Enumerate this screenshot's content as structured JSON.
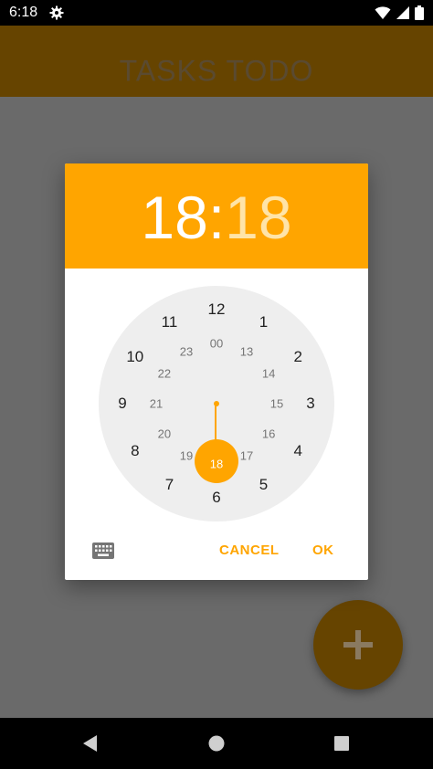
{
  "status_bar": {
    "time": "6:18",
    "icons": [
      "settings-gear-icon",
      "wifi-icon",
      "signal-icon",
      "battery-icon"
    ]
  },
  "app_bar": {
    "title": "TASKS TODO",
    "background": "#664400"
  },
  "time_picker": {
    "hour": "18",
    "separator": ":",
    "minute": "18",
    "accent_color": "#ffa500",
    "selected_hour": "18",
    "outer_ring": [
      "12",
      "1",
      "2",
      "3",
      "4",
      "5",
      "6",
      "7",
      "8",
      "9",
      "10",
      "11"
    ],
    "inner_ring": [
      "00",
      "13",
      "14",
      "15",
      "16",
      "17",
      "18",
      "19",
      "20",
      "21",
      "22",
      "23"
    ],
    "keyboard_icon": "keyboard-icon",
    "cancel_label": "CANCEL",
    "ok_label": "OK"
  },
  "fab": {
    "icon": "plus-icon",
    "background": "#664400"
  },
  "nav_bar": {
    "icons": [
      "back-icon",
      "home-icon",
      "recents-icon"
    ]
  }
}
